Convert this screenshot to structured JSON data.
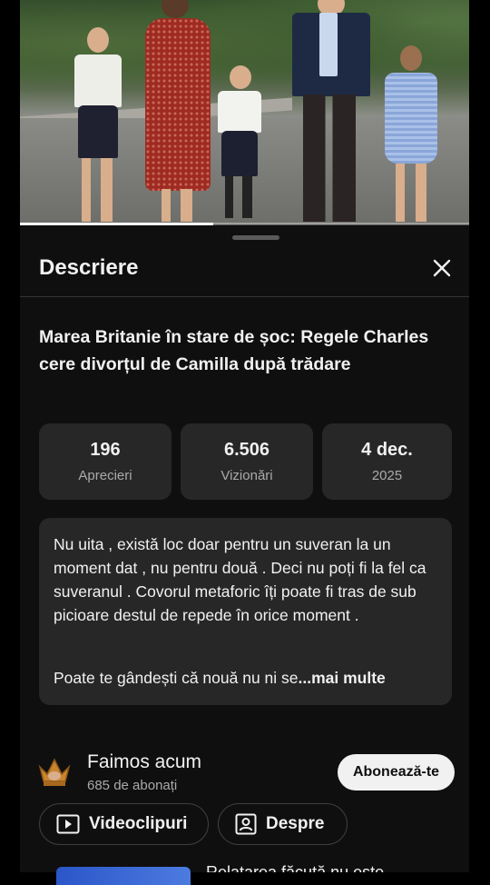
{
  "video": {
    "progress": 0.43
  },
  "sheet": {
    "title": "Descriere",
    "close_icon": "close-icon",
    "video_title": "Marea Britanie în stare de șoc: Regele Charles cere divorțul de Camilla după trădare"
  },
  "stats": [
    {
      "value": "196",
      "label": "Aprecieri"
    },
    {
      "value": "6.506",
      "label": "Vizionări"
    },
    {
      "value": "4 dec.",
      "label": "2025"
    }
  ],
  "description": {
    "text": "Nu uita , există loc doar pentru un suveran la un moment dat , nu pentru două . Deci nu poți fi la fel ca suveranul . Covorul metaforic îți poate fi tras de sub picioare destul de repede în orice moment .",
    "preview": "Poate te gândești că nouă nu ni se",
    "more_label": "...mai multe"
  },
  "channel": {
    "name": "Faimos acum",
    "subscribers": "685 de abonați",
    "subscribe_label": "Abonează-te",
    "avatar_icon": "crown-avatar-icon"
  },
  "buttons": {
    "videos_label": "Videoclipuri",
    "about_label": "Despre",
    "videos_icon": "play-box-icon",
    "about_icon": "person-card-icon"
  },
  "peek": {
    "text": "Relatarea făcută nu este"
  },
  "colors": {
    "sheet_bg": "#0f0f0f",
    "card_bg": "#272727",
    "subscribe_bg": "#f1f1f1",
    "secondary_text": "#aaaaaa"
  }
}
